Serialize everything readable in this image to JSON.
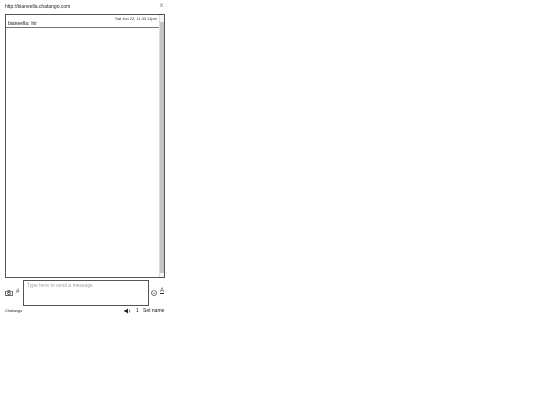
{
  "header": {
    "url": "http://bianeella.chatango.com",
    "close_symbol": "x"
  },
  "messages": [
    {
      "user": "bianeella",
      "text": "hii",
      "timestamp": "Sat Jun 22, 11:33 11pm"
    }
  ],
  "composer": {
    "placeholder": "Type here to send a message",
    "hash_symbol": "#",
    "font_symbol": "A"
  },
  "footer": {
    "brand": "Chatango",
    "user_count": "1",
    "set_name_label": "Set name"
  },
  "icons": {
    "camera": "camera-icon",
    "smiley": "smiley-icon",
    "speaker": "speaker-icon"
  }
}
